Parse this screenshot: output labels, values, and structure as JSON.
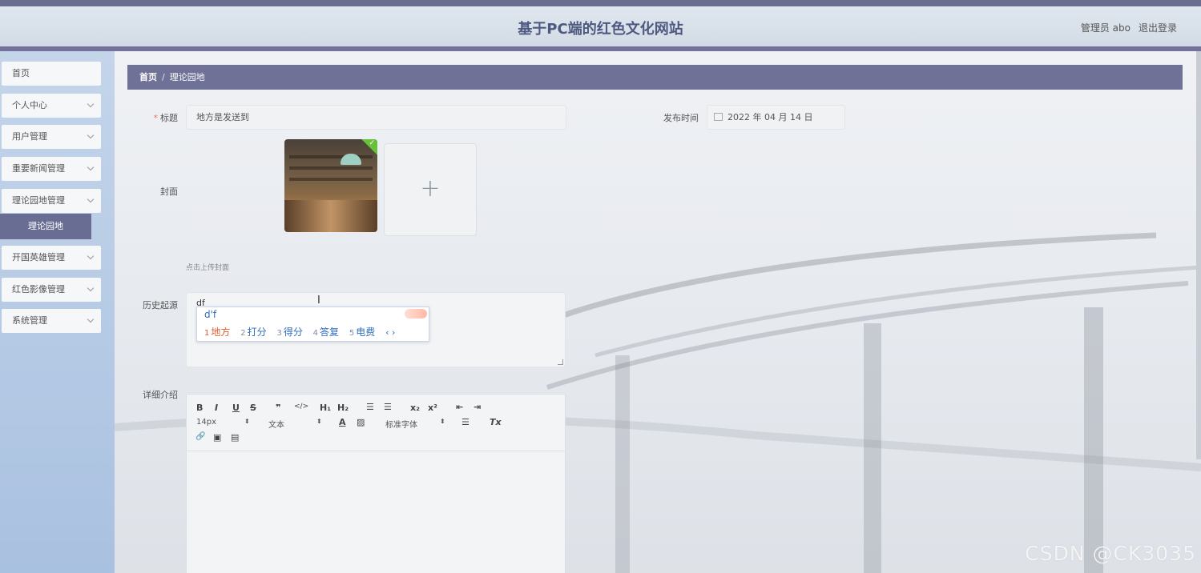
{
  "header": {
    "site_title": "基于PC端的红色文化网站",
    "user_info": "管理员 abo",
    "logout": "退出登录"
  },
  "sidebar": {
    "items": [
      {
        "label": "首页",
        "expandable": false
      },
      {
        "label": "个人中心",
        "expandable": true
      },
      {
        "label": "用户管理",
        "expandable": true
      },
      {
        "label": "重要新闻管理",
        "expandable": true
      },
      {
        "label": "理论园地管理",
        "expandable": true
      },
      {
        "label": "开国英雄管理",
        "expandable": true
      },
      {
        "label": "红色影像管理",
        "expandable": true
      },
      {
        "label": "系统管理",
        "expandable": true
      }
    ],
    "active_sub": "理论园地"
  },
  "breadcrumb": {
    "home": "首页",
    "separator": "/",
    "current": "理论园地"
  },
  "form": {
    "title_label": "标题",
    "title_value": "地方是发送到",
    "publish_label": "发布时间",
    "publish_value": "2022 年 04 月 14 日",
    "cover_label": "封面",
    "cover_hint": "点击上传封面",
    "history_label": "历史起源",
    "history_value": "df",
    "detail_label": "详细介绍"
  },
  "ime": {
    "composition": "d'f",
    "candidates": [
      {
        "num": "1",
        "text": "地方"
      },
      {
        "num": "2",
        "text": "打分"
      },
      {
        "num": "3",
        "text": "得分"
      },
      {
        "num": "4",
        "text": "答复"
      },
      {
        "num": "5",
        "text": "电费"
      }
    ],
    "arrows": "‹ ›"
  },
  "editor_toolbar": {
    "bold": "B",
    "italic": "I",
    "underline": "U",
    "strike": "S",
    "quote": "❞",
    "code": "</>",
    "h1": "H₁",
    "h2": "H₂",
    "ol": "☰",
    "ul": "☰",
    "sub": "x₂",
    "sup": "x²",
    "outdent": "⇤",
    "indent": "⇥",
    "size": "14px",
    "header": "文本",
    "color": "A",
    "background": "▨",
    "font": "标准字体",
    "align": "☰",
    "clean": "Tx",
    "link": "🔗",
    "image": "▣",
    "video": "▤",
    "select_arrow": "⬍"
  },
  "watermark": "CSDN @CK3035"
}
